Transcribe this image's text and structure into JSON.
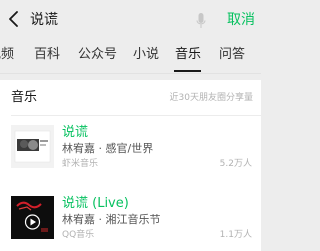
{
  "search": {
    "query": "说谎",
    "cancel_label": "取消"
  },
  "tabs": [
    {
      "label": "视频"
    },
    {
      "label": "百科"
    },
    {
      "label": "公众号"
    },
    {
      "label": "小说"
    },
    {
      "label": "音乐",
      "active": true
    },
    {
      "label": "问答"
    }
  ],
  "music_section": {
    "title": "音乐",
    "note": "近30天朋友圈分享量",
    "songs": [
      {
        "title": "说谎",
        "artist_album": "林宥嘉 · 感官/世界",
        "source": "虾米音乐",
        "plays": "5.2万人"
      },
      {
        "title": "说谎 (Live)",
        "artist_album": "林宥嘉 · 湘江音乐节",
        "source": "QQ音乐",
        "plays": "1.1万人"
      }
    ]
  },
  "colors": {
    "accent": "#07c160",
    "background": "#ededed",
    "card": "#ffffff",
    "muted": "#b2b2b2"
  }
}
